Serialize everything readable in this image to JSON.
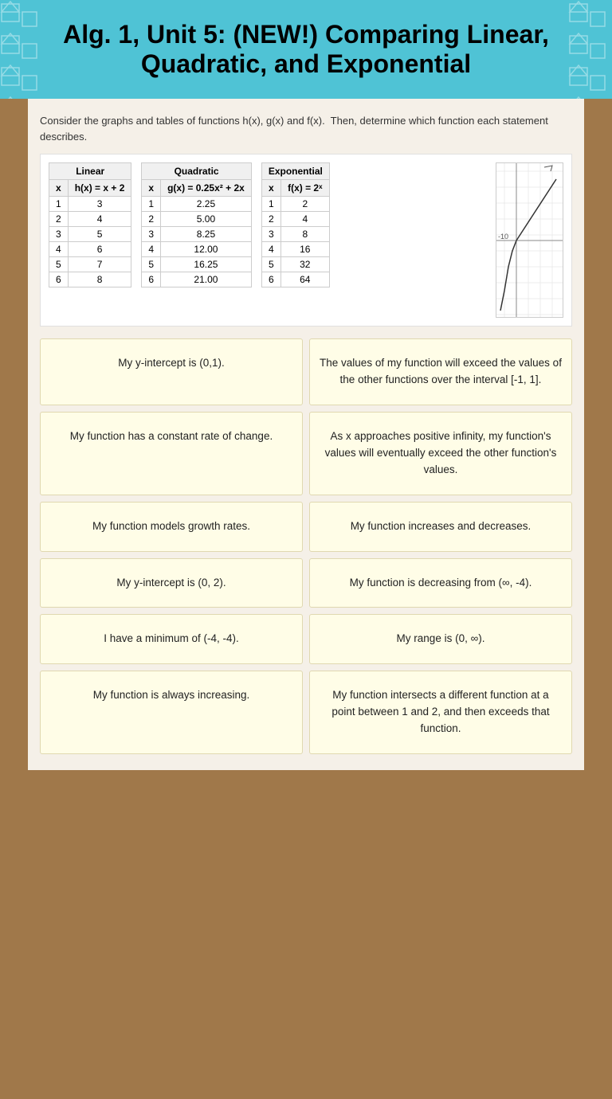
{
  "header": {
    "title": "Alg. 1, Unit 5: (NEW!) Comparing Linear, Quadratic, and Exponential"
  },
  "intro": {
    "text1": "Consider the graphs and tables of functions h(x), g(x) and f(x).  Then, determine which function each statement describes."
  },
  "tables": {
    "linear": {
      "title": "Linear",
      "col1": "x",
      "col2": "h(x) = x + 2",
      "rows": [
        [
          "1",
          "3"
        ],
        [
          "2",
          "4"
        ],
        [
          "3",
          "5"
        ],
        [
          "4",
          "6"
        ],
        [
          "5",
          "7"
        ],
        [
          "6",
          "8"
        ]
      ]
    },
    "quadratic": {
      "title": "Quadratic",
      "col1": "x",
      "col2": "g(x) = 0.25x² + 2x",
      "rows": [
        [
          "1",
          "2.25"
        ],
        [
          "2",
          "5.00"
        ],
        [
          "3",
          "8.25"
        ],
        [
          "4",
          "12.00"
        ],
        [
          "5",
          "16.25"
        ],
        [
          "6",
          "21.00"
        ]
      ]
    },
    "exponential": {
      "title": "Exponential",
      "col1": "x",
      "col2": "f(x) = 2ˣ",
      "rows": [
        [
          "1",
          "2"
        ],
        [
          "2",
          "4"
        ],
        [
          "3",
          "8"
        ],
        [
          "4",
          "16"
        ],
        [
          "5",
          "32"
        ],
        [
          "6",
          "64"
        ]
      ]
    }
  },
  "cards": [
    {
      "id": "card1",
      "text": "My y-intercept is (0,1)."
    },
    {
      "id": "card2",
      "text": "The values of my function will exceed the values of the other functions over the interval [-1, 1]."
    },
    {
      "id": "card3",
      "text": "My function has a constant rate of change."
    },
    {
      "id": "card4",
      "text": "As x approaches positive infinity,\nmy function's values will eventually\nexceed the other function's values."
    },
    {
      "id": "card5",
      "text": "My function models growth rates."
    },
    {
      "id": "card6",
      "text": "My function increases and decreases."
    },
    {
      "id": "card7",
      "text": "My y-intercept is (0, 2)."
    },
    {
      "id": "card8",
      "text": "My function is decreasing from (∞, -4)."
    },
    {
      "id": "card9",
      "text": "I have a minimum of (-4, -4)."
    },
    {
      "id": "card10",
      "text": "My range is (0, ∞)."
    },
    {
      "id": "card11",
      "text": "My function is always increasing."
    },
    {
      "id": "card12",
      "text": "My function intersects a different function at a point between 1 and 2, and then exceeds that function."
    }
  ]
}
